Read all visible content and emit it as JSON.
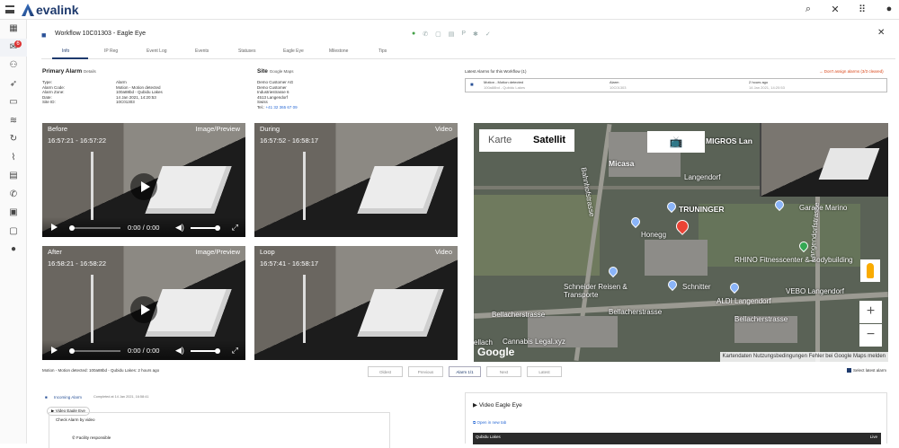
{
  "app": {
    "logo": "evalink"
  },
  "topbar": {
    "icons": [
      "search-icon",
      "tools-icon",
      "apps-grid-icon",
      "account-icon"
    ]
  },
  "sidebar": {
    "badge": "6"
  },
  "workflow": {
    "title": "Workflow 10C01303 - Eagle Eye",
    "tabs": [
      "Info",
      "IP Reg",
      "Event Log",
      "Events",
      "Statuses",
      "Eagle Eye",
      "Milestone",
      "Tips"
    ]
  },
  "primary_alarm": {
    "heading": "Primary Alarm",
    "details_link": "Details",
    "rows": [
      {
        "label": "Type:",
        "value": "Alarm"
      },
      {
        "label": "Alarm Code:",
        "value": "Motion - Motion detected"
      },
      {
        "label": "Alarm Zone:",
        "value": "100a88bd - Qubidu Lakes"
      },
      {
        "label": "Date:",
        "value": "14 Jan 2021, 14:20:53"
      },
      {
        "label": "Site ID:",
        "value": "10C01303"
      }
    ]
  },
  "site": {
    "heading": "Site",
    "maps_link": "Google Maps",
    "lines": [
      "Demo Customer AG",
      "Demo Customer",
      "Industriestrasse 6",
      "4513 Langendorf",
      "Swiss"
    ],
    "tel_label": "Tel.:",
    "tel": "+41 32 365 67 09"
  },
  "latest_alarms": {
    "title": "Latest Alarms for this Workflow (1)",
    "unassign": "Don't assign alarms (3/3 cleared)",
    "row": {
      "col1": "Motion - Motion detected",
      "col1_sub": "100a88bd - Qubidu Lakes",
      "col2": "Alarm",
      "col2_sub": "10C01303",
      "col3": "2 hours ago",
      "col3_sub": "14 Jan 2021, 14:20:53"
    }
  },
  "videos": [
    {
      "label": "Before",
      "time": "16:57:21 - 16:57:22",
      "kind": "Image/Preview",
      "player_time": "0:00 / 0:00"
    },
    {
      "label": "During",
      "time": "16:57:52 - 16:58:17",
      "kind": "Video"
    },
    {
      "label": "After",
      "time": "16:58:21 - 16:58:22",
      "kind": "Image/Preview",
      "player_time": "0:00 / 0:00"
    },
    {
      "label": "Loop",
      "time": "16:57:41 - 16:58:17",
      "kind": "Video"
    }
  ],
  "map": {
    "type_map": "Karte",
    "type_satellite": "Satellit",
    "labels": {
      "micasa": "Micasa",
      "migros": "MIGROS Lan",
      "langendorf": "Langendorf",
      "truninger": "TRUNINGER",
      "garage": "Garage Marino",
      "honegg": "Honegg",
      "rhino": "RHINO Fitnesscenter & Bodybuilding",
      "schneider": "Schneider Reisen & Transporte",
      "schnitter": "Schnitter",
      "vebo": "VEBO Langendorf",
      "aldi": "ALDI Langendorf",
      "bellacher1": "Bellacherstrasse",
      "bellacher2": "Bellacherstrasse",
      "bellacher3": "Bellacherstrasse",
      "cannabis": "Cannabis Legal.xyz",
      "ellach": "ellach",
      "bahnhof": "Bahnhofstrasse",
      "langendorf_str": "Langendorfstrasse"
    },
    "google": "Google",
    "footer": "Kartendaten  Nutzungsbedingungen  Fehler bei Google Maps melden"
  },
  "status": {
    "text": "Motion - Motion detected: 100a88bd - Qubidu Lakes: 2 hours ago",
    "buttons": [
      "Oldest",
      "Previous",
      "Alarm 1/1",
      "Next",
      "Latest"
    ],
    "select_latest": "Select latest alarm"
  },
  "bottom_left": {
    "incoming": "Incoming Alarm",
    "incoming_sub": "Completed at 14 Jan 2021, 16:58:41",
    "video_chip": "Video Eagle Eye",
    "check": "Check Alarm by video",
    "facility": "Facility responsible"
  },
  "bottom_right": {
    "title": "Video Eagle Eye",
    "link": "Open in new tab",
    "cam": "Qubidu Lakes",
    "live": "Live"
  }
}
